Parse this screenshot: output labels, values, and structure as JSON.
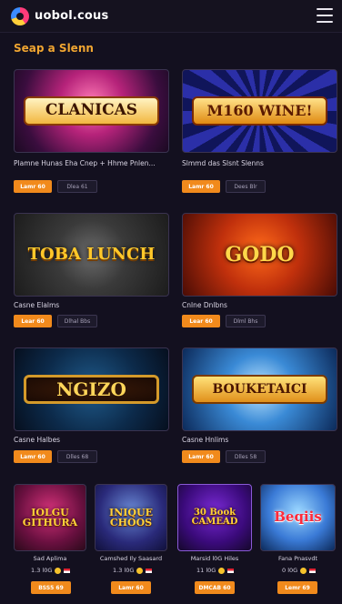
{
  "header": {
    "logo_text": "uobol.cous"
  },
  "section": {
    "title": "Seap a Slenn"
  },
  "games_large": [
    {
      "banner": "CLANICAS",
      "title": "Plamne Hunas Eha Cnep + Hhme Pnlen...",
      "play": "Lamr 60",
      "demo": "Dlea 61"
    },
    {
      "banner": "M160 WINE!",
      "title": "Slmmd das Slsnt Slenns",
      "play": "Lamr 60",
      "demo": "Dees Blr"
    },
    {
      "banner": "TOBA LUNCH",
      "title": "Casne Elalms",
      "play": "Lear 60",
      "demo": "Dlhal Bbs"
    },
    {
      "banner": "GODO",
      "title": "Cnlne Dnlbns",
      "play": "Lear 60",
      "demo": "Dlml Bhs"
    },
    {
      "banner": "NGIZO",
      "title": "Casne Halbes",
      "play": "Lamr 60",
      "demo": "Dlles 68"
    },
    {
      "banner": "BOUKETAICI",
      "title": "Casne Hnlims",
      "play": "Lamr 60",
      "demo": "Dlles 58"
    }
  ],
  "games_small": [
    {
      "banner": "IOLGU GITHURA",
      "title": "Sad Aplima",
      "amount": "1.3 l0G",
      "play": "BSS5 69"
    },
    {
      "banner": "INIQUE CHOOS",
      "title": "Camshed Ily Saasard",
      "amount": "1.3 l0G",
      "play": "Lamr 60"
    },
    {
      "banner": "30 Book CAMEAD",
      "title": "Marsid l0G Hiles",
      "amount": "11 l0G",
      "play": "DMCAB 60"
    },
    {
      "banner": "Beqiis",
      "title": "Fana Pnasvdt",
      "amount": "0 l0G",
      "play": "Lemr 69"
    }
  ],
  "colors": {
    "accent": "#f18a1c",
    "title_gold": "#f0a531",
    "background": "#13101f"
  },
  "icons": {
    "menu": "hamburger-menu-icon",
    "coin": "coin-icon",
    "flag": "flag-icon",
    "logo": "logo-icon"
  }
}
